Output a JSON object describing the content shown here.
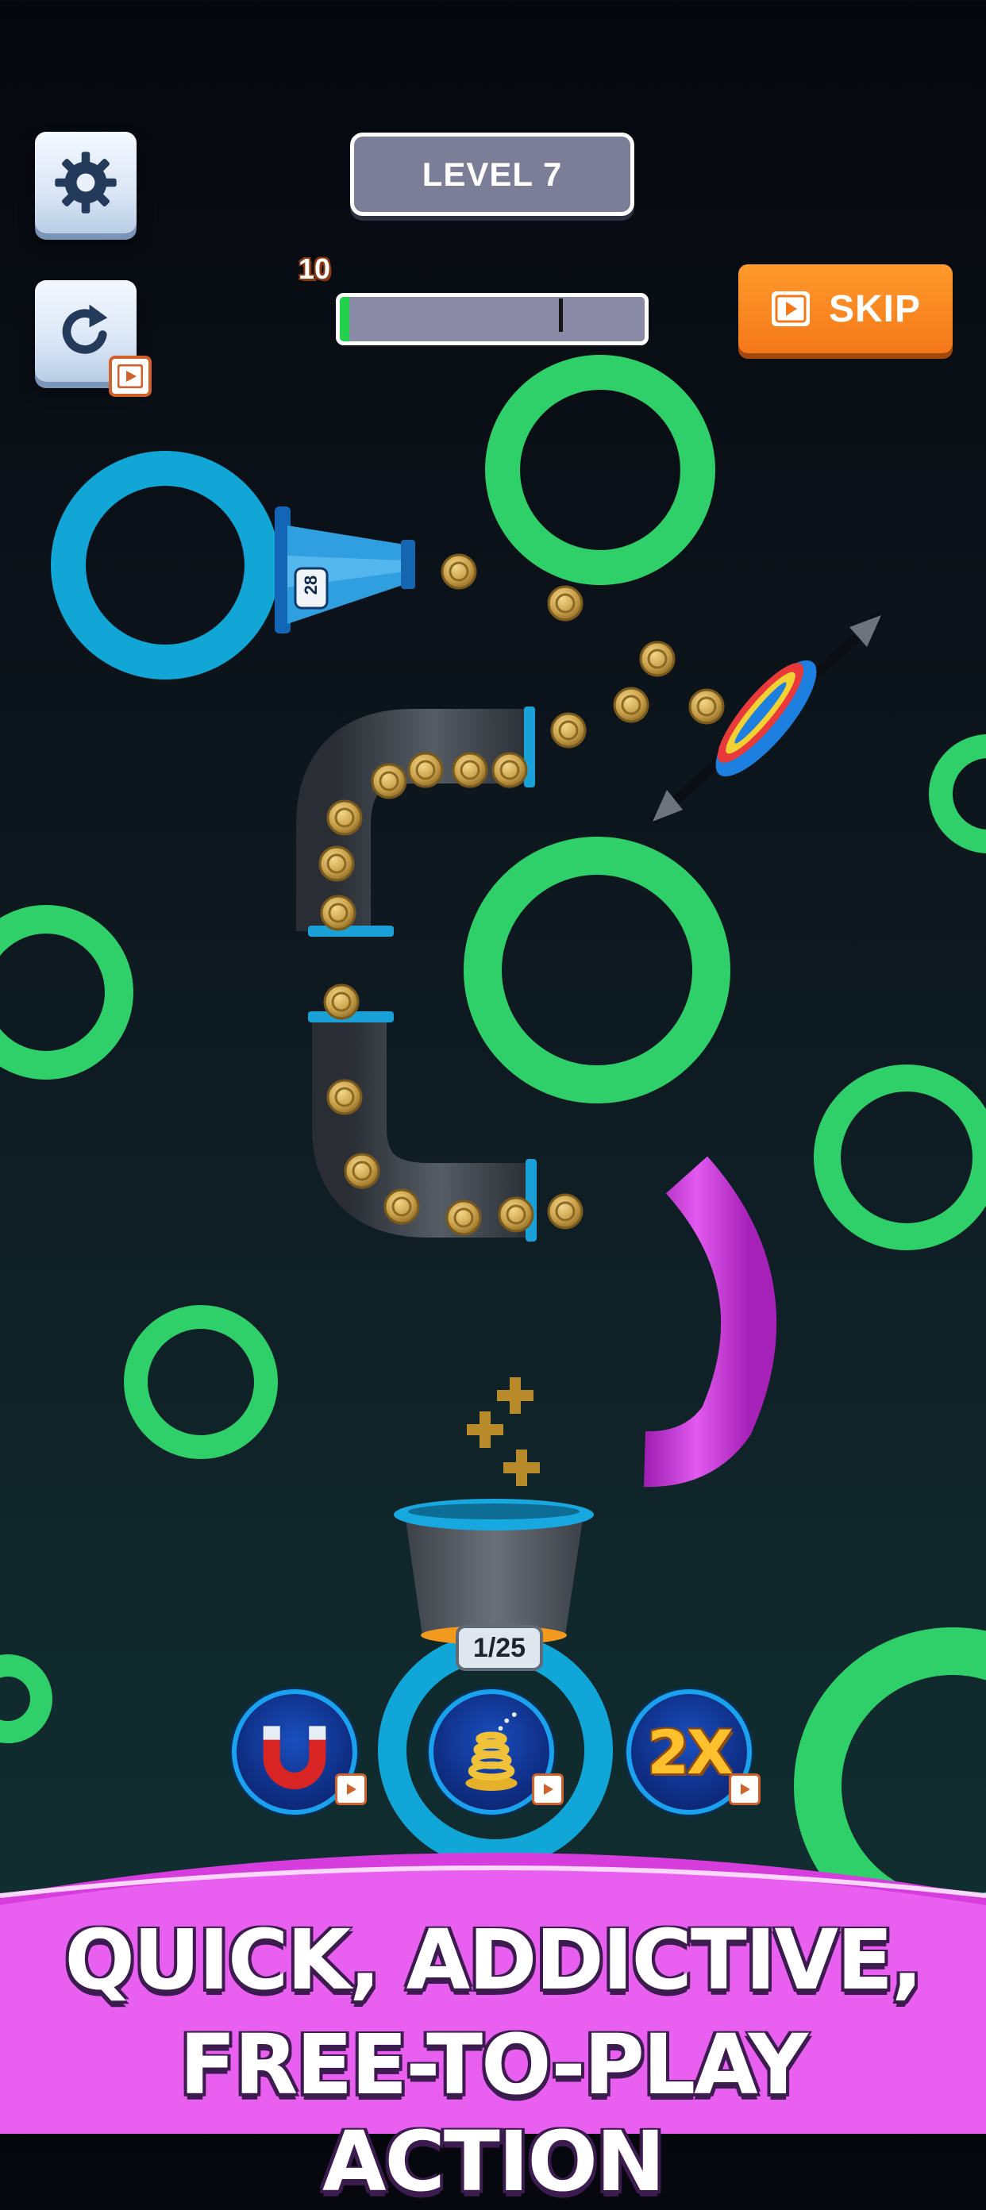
{
  "hud": {
    "level_label": "LEVEL 7",
    "score": "10",
    "progress": 0.03,
    "progress_target": 0.72,
    "skip_label": "SKIP",
    "settings_icon": "gear-icon",
    "restart_icon": "restart-icon"
  },
  "game": {
    "cannon_ammo": "28",
    "cup_counter": "1/25"
  },
  "boosters": [
    {
      "name": "magnet",
      "icon": "magnet-icon"
    },
    {
      "name": "spring-cup",
      "icon": "spring-icon"
    },
    {
      "name": "double",
      "icon": "2x-icon",
      "label": "2X"
    }
  ],
  "banner": {
    "line1": "QUICK, ADDICTIVE,",
    "line2": "FREE-TO-PLAY ACTION"
  },
  "colors": {
    "ring_green": "#2fd06a",
    "ring_blue": "#12a6d6",
    "pipe_purple": "#c92bd6",
    "banner_pink": "#e94ff0",
    "skip_orange": "#f4781a",
    "coin_gold": "#c9a247"
  }
}
